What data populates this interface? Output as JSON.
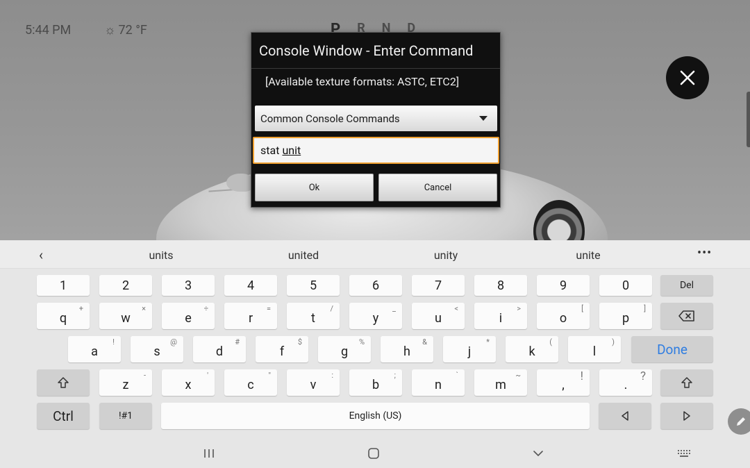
{
  "status": {
    "time": "5:44 PM",
    "temperature": "72 °F"
  },
  "gears": [
    "P",
    "R",
    "N",
    "D"
  ],
  "dialog": {
    "title": "Console Window - Enter Command",
    "message": "[Available texture formats: ASTC, ETC2]",
    "dropdown_selected": "Common Console Commands",
    "input_prefix": "stat",
    "input_current_word": "unit",
    "ok_label": "Ok",
    "cancel_label": "Cancel"
  },
  "keyboard": {
    "suggestions": [
      "units",
      "united",
      "unity",
      "unite"
    ],
    "number_row": [
      "1",
      "2",
      "3",
      "4",
      "5",
      "6",
      "7",
      "8",
      "9",
      "0"
    ],
    "del_label": "Del",
    "row_q": [
      {
        "key": "q",
        "alt": "+"
      },
      {
        "key": "w",
        "alt": "×"
      },
      {
        "key": "e",
        "alt": "÷"
      },
      {
        "key": "r",
        "alt": "="
      },
      {
        "key": "t",
        "alt": "/"
      },
      {
        "key": "y",
        "alt": "_"
      },
      {
        "key": "u",
        "alt": "<"
      },
      {
        "key": "i",
        "alt": ">"
      },
      {
        "key": "o",
        "alt": "["
      },
      {
        "key": "p",
        "alt": "]"
      }
    ],
    "row_a": [
      {
        "key": "a",
        "alt": "!"
      },
      {
        "key": "s",
        "alt": "@"
      },
      {
        "key": "d",
        "alt": "#"
      },
      {
        "key": "f",
        "alt": "$"
      },
      {
        "key": "g",
        "alt": "%"
      },
      {
        "key": "h",
        "alt": "&"
      },
      {
        "key": "j",
        "alt": "*"
      },
      {
        "key": "k",
        "alt": "("
      },
      {
        "key": "l",
        "alt": ")"
      }
    ],
    "done_label": "Done",
    "row_z": [
      {
        "key": "z",
        "alt": "-"
      },
      {
        "key": "x",
        "alt": "'"
      },
      {
        "key": "c",
        "alt": "\""
      },
      {
        "key": "v",
        "alt": ":"
      },
      {
        "key": "b",
        "alt": ";"
      },
      {
        "key": "n",
        "alt": "`"
      },
      {
        "key": "m",
        "alt": "~"
      },
      {
        "key": ",",
        "alt": "!"
      },
      {
        "key": ".",
        "alt": "?"
      }
    ],
    "ctrl_label": "Ctrl",
    "symbols_label": "!#1",
    "space_label": "English (US)"
  },
  "colors": {
    "done_blue": "#2f7de1",
    "input_focus": "#f0a030"
  }
}
